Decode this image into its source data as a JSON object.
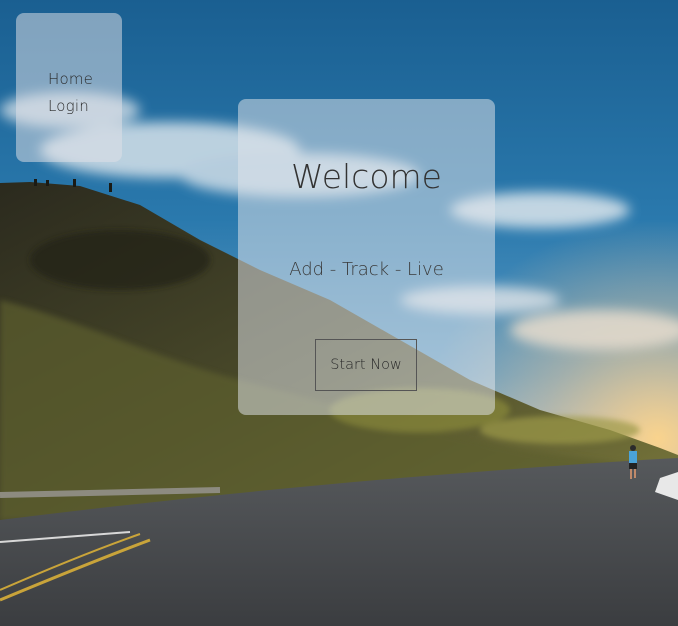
{
  "nav": {
    "items": [
      {
        "label": "Home"
      },
      {
        "label": "Login"
      }
    ]
  },
  "hero": {
    "title": "Welcome",
    "tagline": "Add - Track - Live",
    "cta_label": "Start Now"
  },
  "theme": {
    "card_tint": "#e1e4e9",
    "text_color": "#333333",
    "sky_color": "#1f6a9c"
  },
  "background": {
    "icon": "landscape-photo-road-runner"
  }
}
